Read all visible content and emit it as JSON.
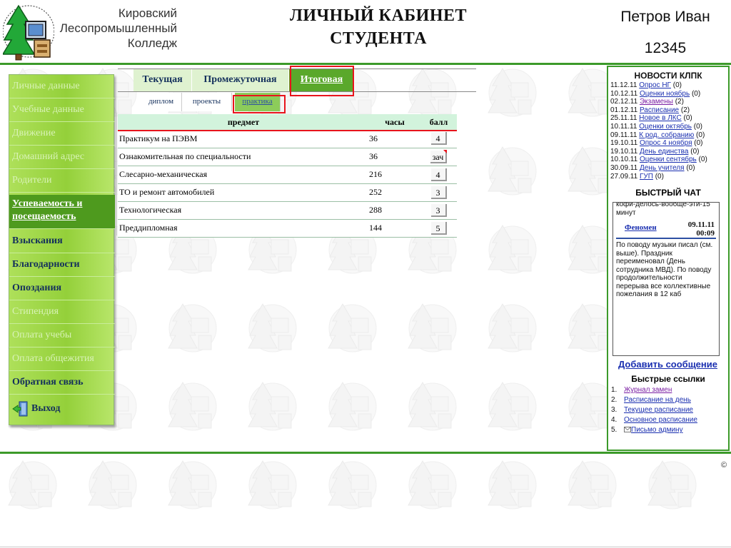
{
  "header": {
    "college_name": [
      "Кировский",
      "Лесопромышленный",
      "Колледж"
    ],
    "title_lines": [
      "ЛИЧНЫЙ КАБИНЕТ",
      "СТУДЕНТА"
    ],
    "user_name": "Петров Иван",
    "user_id": "12345",
    "accent_color": "#3c9a2a"
  },
  "left_menu": {
    "items": [
      {
        "label": "Личные данные",
        "state": "disabled"
      },
      {
        "label": "Учебные данные",
        "state": "disabled"
      },
      {
        "label": "Движение",
        "state": "disabled"
      },
      {
        "label": "Домашний адрес",
        "state": "disabled"
      },
      {
        "label": "Родители",
        "state": "disabled"
      },
      {
        "label": "Успеваемость и посещаемость",
        "state": "active"
      },
      {
        "label": "Взыскания",
        "state": "enabled"
      },
      {
        "label": "Благодарности",
        "state": "enabled"
      },
      {
        "label": "Опоздания",
        "state": "enabled"
      },
      {
        "label": "Стипендия",
        "state": "disabled"
      },
      {
        "label": "Оплата учебы",
        "state": "disabled"
      },
      {
        "label": "Оплата общежития",
        "state": "disabled"
      },
      {
        "label": "Обратная связь",
        "state": "enabled"
      },
      {
        "label": "Выход",
        "state": "enabled",
        "icon": "exit-door-icon"
      }
    ]
  },
  "tabs": {
    "items": [
      {
        "label": "Текущая",
        "active": false
      },
      {
        "label": "Промежуточная",
        "active": false
      },
      {
        "label": "Итоговая",
        "active": true
      }
    ]
  },
  "subtabs": {
    "items": [
      {
        "label": "диплом",
        "active": false
      },
      {
        "label": "проекты",
        "active": false
      },
      {
        "label": "практика",
        "active": true
      }
    ]
  },
  "grades": {
    "columns": {
      "subject": "предмет",
      "hours": "часы",
      "grade": "балл"
    },
    "rows": [
      {
        "subject": "Практикум на ПЭВМ",
        "hours": "36",
        "grade": "4",
        "flag": false
      },
      {
        "subject": "Ознакомительная по специальности",
        "hours": "36",
        "grade": "зач",
        "flag": true
      },
      {
        "subject": "Слесарно-механическая",
        "hours": "216",
        "grade": "4",
        "flag": false
      },
      {
        "subject": "ТО и ремонт автомобилей",
        "hours": "252",
        "grade": "3",
        "flag": false
      },
      {
        "subject": "Технологическая",
        "hours": "288",
        "grade": "3",
        "flag": false
      },
      {
        "subject": "Преддипломная",
        "hours": "144",
        "grade": "5",
        "flag": false
      }
    ]
  },
  "news": {
    "title": "НОВОСТИ КЛПК",
    "items": [
      {
        "date": "11.12.11",
        "link": "Опрос НГ",
        "count": "(0)"
      },
      {
        "date": "10.12.11",
        "link": "Оценки ноябрь",
        "count": "(0)"
      },
      {
        "date": "02.12.11",
        "link": "Экзамены",
        "count": "(2)"
      },
      {
        "date": "01.12.11",
        "link": "Расписание",
        "count": "(2)"
      },
      {
        "date": "25.11.11",
        "link": "Новое в ЛКС",
        "count": "(0)"
      },
      {
        "date": "10.11.11",
        "link": "Оценки октябрь",
        "count": "(0)"
      },
      {
        "date": "09.11.11",
        "link": "К род. собранию",
        "count": "(0)"
      },
      {
        "date": "19.10.11",
        "link": "Опрос 4 ноября",
        "count": "(0)"
      },
      {
        "date": "19.10.11",
        "link": "День единства",
        "count": "(0)"
      },
      {
        "date": "10.10.11",
        "link": "Оценки сентябрь",
        "count": "(0)"
      },
      {
        "date": "30.09.11",
        "link": "День учителя",
        "count": "(0)"
      },
      {
        "date": "27.09.11",
        "link": "ГУП",
        "count": "(0)"
      }
    ]
  },
  "chat": {
    "title": "БЫСТРЫЙ ЧАТ",
    "previous_tail": "кофи-делось-вообще-эти-15 минут",
    "author": "Феномен",
    "date": "09.11.11",
    "time": "00:09",
    "message": "По поводу музыки писал (см. выше). Праздник переименовал (День сотрудника МВД). По поводу продолжительности перерыва все коллективные пожелания в 12 каб",
    "add_label": "Добавить сообщение"
  },
  "quick_links": {
    "title": "Быстрые ссылки",
    "items": [
      {
        "num": "1.",
        "label": "Журнал замен",
        "visited": true
      },
      {
        "num": "2.",
        "label": "Расписание на день",
        "visited": false
      },
      {
        "num": "3.",
        "label": "Текущее расписание",
        "visited": false
      },
      {
        "num": "4.",
        "label": "Основное расписание",
        "visited": false
      },
      {
        "num": "5.",
        "label": "Письмо админу",
        "visited": false,
        "icon": "envelope-icon"
      }
    ]
  },
  "footer": {
    "copyright": "©"
  }
}
